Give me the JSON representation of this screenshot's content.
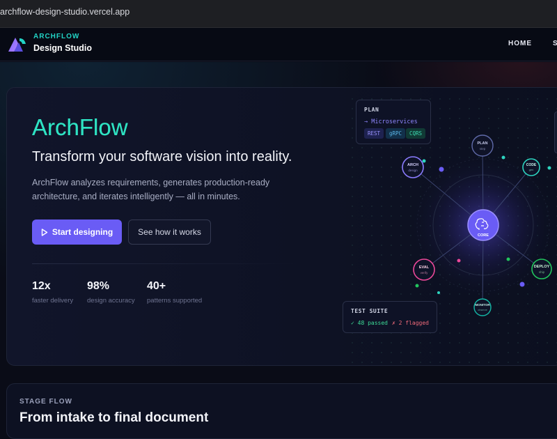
{
  "browser": {
    "url": "archflow-design-studio.vercel.app"
  },
  "header": {
    "brand_top": "ARCHFLOW",
    "brand_bottom": "Design Studio",
    "nav": [
      "HOME",
      "S"
    ]
  },
  "hero": {
    "title": "ArchFlow",
    "subtitle": "Transform your software vision into reality.",
    "description": "ArchFlow analyzes requirements, generates production-ready architecture, and iterates intelligently — all in minutes.",
    "primary_button": "Start designing",
    "secondary_button": "See how it works",
    "stats": [
      {
        "value": "12x",
        "label": "faster delivery"
      },
      {
        "value": "98%",
        "label": "design accuracy"
      },
      {
        "value": "40+",
        "label": "patterns supported"
      }
    ]
  },
  "diagram": {
    "plan_card": {
      "heading": "PLAN",
      "item": "→ Microservices",
      "chips": [
        "REST",
        "gRPC",
        "CQRS"
      ]
    },
    "test_card": {
      "heading": "TEST SUITE",
      "passed": "✓ 48 passed",
      "flagged": "✗ 2 flagged"
    },
    "core": {
      "label": "CORE"
    },
    "nodes": [
      {
        "id": "plan",
        "title": "PLAN",
        "sub": "step",
        "color": "#6f7bd8"
      },
      {
        "id": "arch",
        "title": "ARCH",
        "sub": "design",
        "color": "#8b7cff"
      },
      {
        "id": "code",
        "title": "CODE",
        "sub": "gen",
        "color": "#2dd4bf"
      },
      {
        "id": "eval",
        "title": "EVAL",
        "sub": "verify",
        "color": "#ec4899"
      },
      {
        "id": "deploy",
        "title": "DEPLOY",
        "sub": "ship",
        "color": "#22c55e"
      },
      {
        "id": "monitor",
        "title": "MONITOR",
        "sub": "observe",
        "color": "#14b8a6"
      }
    ]
  },
  "stage_flow": {
    "kicker": "STAGE FLOW",
    "title": "From intake to final document"
  },
  "colors": {
    "accent": "#6a5cf5",
    "teal": "#2ee3c3",
    "background": "#0a0c17"
  }
}
